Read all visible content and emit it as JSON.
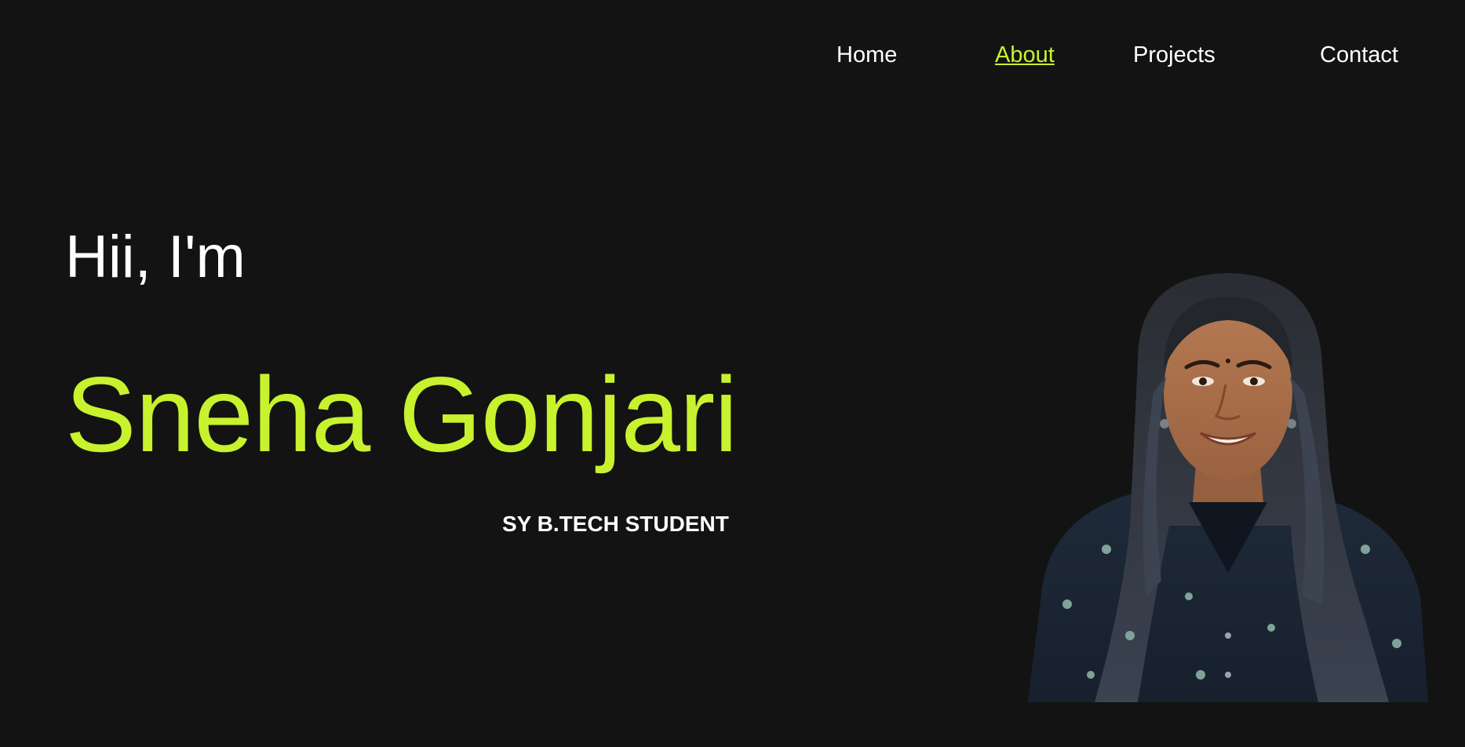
{
  "nav": {
    "items": [
      {
        "label": "Home",
        "active": false
      },
      {
        "label": "About",
        "active": true
      },
      {
        "label": "Projects",
        "active": false
      },
      {
        "label": "Contact",
        "active": false
      }
    ]
  },
  "hero": {
    "greeting": "Hii, I'm",
    "name": "Sneha Gonjari",
    "role": "SY B.TECH STUDENT"
  },
  "colors": {
    "background": "#131313",
    "accent": "#c8f22d",
    "text": "#ffffff"
  }
}
